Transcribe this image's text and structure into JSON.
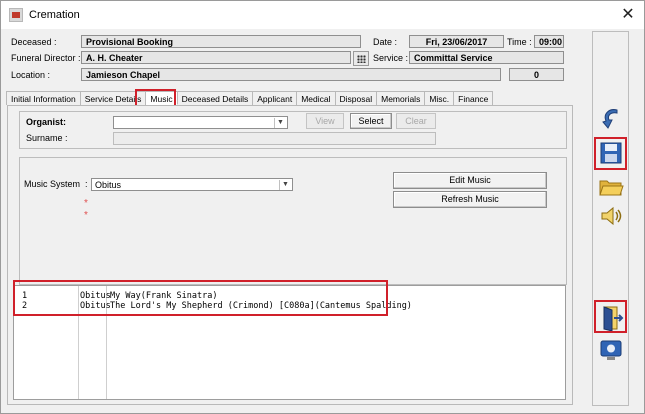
{
  "window": {
    "title": "Cremation",
    "close_glyph": "✕"
  },
  "header": {
    "deceased_label": "Deceased :",
    "deceased_value": "Provisional Booking",
    "date_label": "Date :",
    "date_value": "Fri, 23/06/2017",
    "time_label": "Time :",
    "time_value": "09:00",
    "funeral_director_label": "Funeral Director :",
    "funeral_director_value": "A. H. Cheater",
    "service_label": "Service :",
    "service_value": "Committal Service",
    "location_label": "Location :",
    "location_value": "Jamieson Chapel",
    "count_value": "0"
  },
  "tabs": [
    {
      "label": "Initial Information"
    },
    {
      "label": "Service Details"
    },
    {
      "label": "Music"
    },
    {
      "label": "Deceased Details"
    },
    {
      "label": "Applicant"
    },
    {
      "label": "Medical"
    },
    {
      "label": "Disposal"
    },
    {
      "label": "Memorials"
    },
    {
      "label": "Misc."
    },
    {
      "label": "Finance"
    }
  ],
  "active_tab": "Music",
  "organist": {
    "label": "Organist:",
    "value": "",
    "surname_label": "Surname :",
    "surname_value": "",
    "view_label": "View",
    "select_label": "Select",
    "clear_label": "Clear"
  },
  "music_system": {
    "label": "Music System",
    "colon": ":",
    "value": "Obitus",
    "required_marks": [
      "*",
      "*"
    ],
    "edit_label": "Edit Music",
    "refresh_label": "Refresh Music"
  },
  "music_list": [
    {
      "num": "1",
      "system": "Obitus",
      "title": "My Way(Frank Sinatra)"
    },
    {
      "num": "2",
      "system": "Obitus",
      "title": "The Lord's My Shepherd (Crimond) [C080a](Cantemus Spalding)"
    }
  ],
  "toolbar_icons": [
    "undo-icon",
    "save-icon",
    "open-folder-icon",
    "speaker-icon",
    "exit-door-icon",
    "monitor-icon"
  ],
  "colors": {
    "highlight_red": "#d0202a",
    "window_bg": "#f0f0f0"
  }
}
